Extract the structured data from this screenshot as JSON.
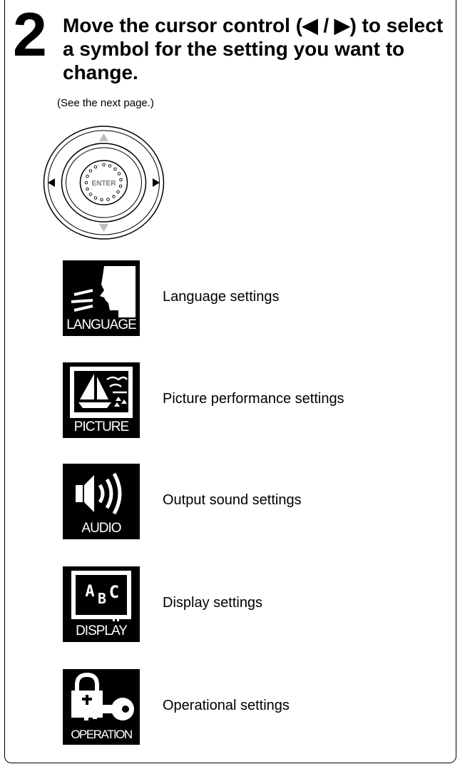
{
  "step": {
    "number": "2",
    "instruction": "Move the cursor control (◀ / ▶) to select a symbol for the setting you want to change.",
    "note": "(See the next page.)"
  },
  "dial": {
    "center_label": "ENTER",
    "arrows": [
      "up-arrow",
      "down-arrow",
      "left-arrow",
      "right-arrow"
    ]
  },
  "settings": [
    {
      "icon": "language-icon",
      "tile_label": "LANGUAGE",
      "description": "Language settings"
    },
    {
      "icon": "picture-icon",
      "tile_label": "PICTURE",
      "description": "Picture performance settings"
    },
    {
      "icon": "audio-icon",
      "tile_label": "AUDIO",
      "description": "Output sound settings"
    },
    {
      "icon": "display-icon",
      "tile_label": "DISPLAY",
      "description": "Display settings"
    },
    {
      "icon": "operation-icon",
      "tile_label": "OPERATION",
      "description": "Operational settings"
    }
  ]
}
